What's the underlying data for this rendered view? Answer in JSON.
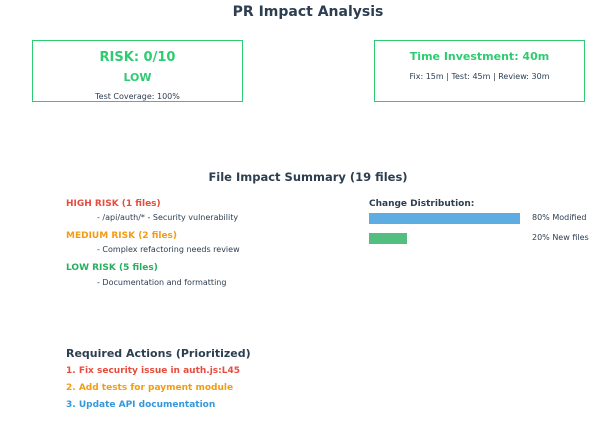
{
  "title": "PR Impact Analysis",
  "risk_card": {
    "score": "RISK: 0/10",
    "level": "LOW",
    "coverage": "Test Coverage: 100%"
  },
  "time_card": {
    "title": "Time Investment: 40m",
    "breakdown": "Fix: 15m | Test: 45m | Review: 30m"
  },
  "summary": {
    "title": "File Impact Summary (19 files)",
    "groups": [
      {
        "heading": "HIGH RISK (1 files)",
        "description": "- /api/auth/* - Security vulnerability",
        "color": "#e74c3c"
      },
      {
        "heading": "MEDIUM RISK (2 files)",
        "description": "- Complex refactoring needs review",
        "color": "#f39c12"
      },
      {
        "heading": "LOW RISK (5 files)",
        "description": "- Documentation and formatting",
        "color": "#27ae60"
      }
    ]
  },
  "distribution": {
    "title": "Change Distribution:",
    "bars": [
      {
        "label": "80% Modified",
        "value": 0.8,
        "color": "#5dade2"
      },
      {
        "label": "20% New files",
        "value": 0.2,
        "color": "#52be80"
      }
    ]
  },
  "actions": {
    "title": "Required Actions (Prioritized)",
    "items": [
      {
        "text": "1. Fix security issue in auth.js:L45",
        "color": "#e74c3c"
      },
      {
        "text": "2. Add tests for payment module",
        "color": "#f39c12"
      },
      {
        "text": "3. Update API documentation",
        "color": "#3498db"
      }
    ]
  },
  "colors": {
    "accent_green": "#2ecc71",
    "text_dark": "#2c3e50"
  }
}
